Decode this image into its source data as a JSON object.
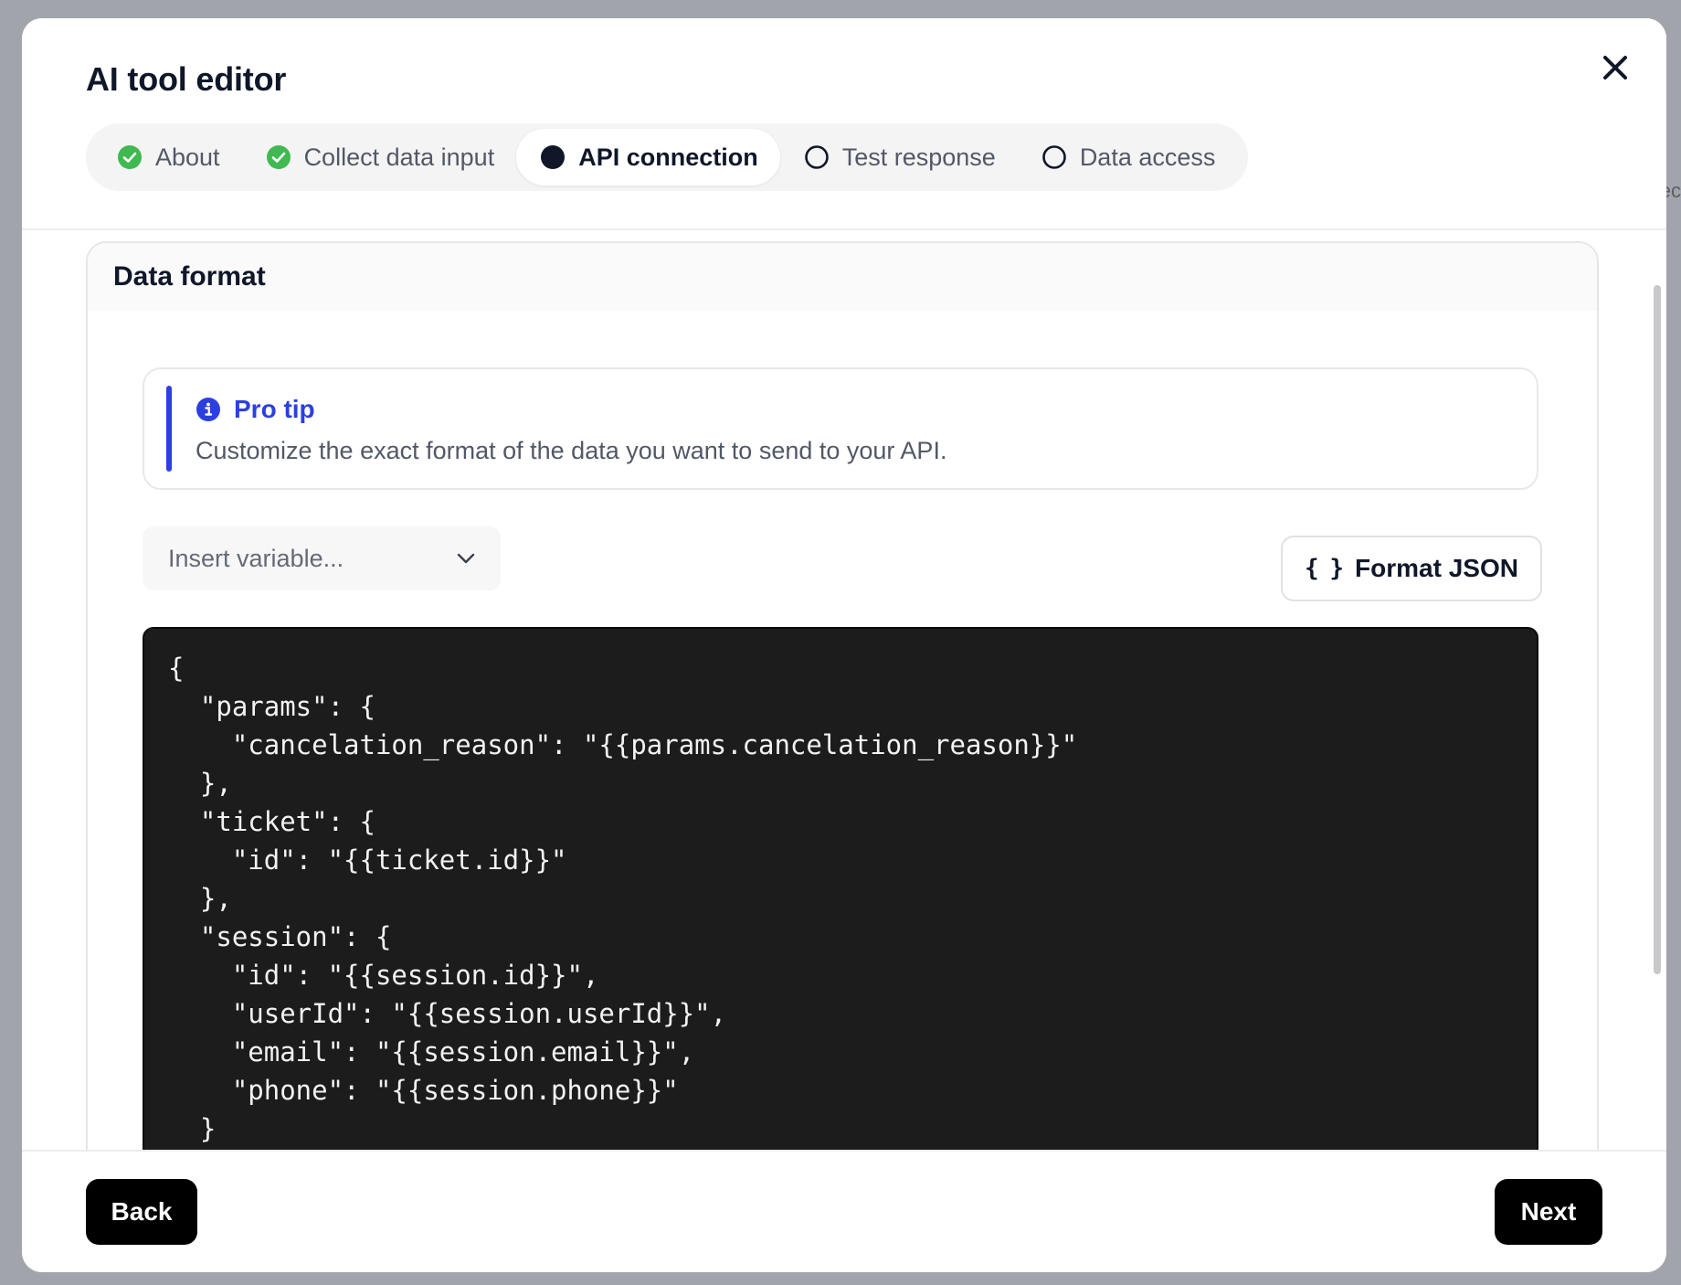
{
  "modal": {
    "title": "AI tool editor"
  },
  "steps": [
    {
      "label": "About",
      "state": "complete"
    },
    {
      "label": "Collect data input",
      "state": "complete"
    },
    {
      "label": "API connection",
      "state": "active"
    },
    {
      "label": "Test response",
      "state": "pending"
    },
    {
      "label": "Data access",
      "state": "pending"
    }
  ],
  "section": {
    "title": "Data format"
  },
  "tip": {
    "title": "Pro tip",
    "text": "Customize the exact format of the data you want to send to your API."
  },
  "insert_variable": {
    "placeholder": "Insert variable..."
  },
  "format_button": {
    "icon_text": "{ }",
    "label": "Format JSON"
  },
  "code": {
    "content": "{\n  \"params\": {\n    \"cancelation_reason\": \"{{params.cancelation_reason}}\"\n  },\n  \"ticket\": {\n    \"id\": \"{{ticket.id}}\"\n  },\n  \"session\": {\n    \"id\": \"{{session.id}}\",\n    \"userId\": \"{{session.userId}}\",\n    \"email\": \"{{session.email}}\",\n    \"phone\": \"{{session.phone}}\"\n  }"
  },
  "footer": {
    "back_label": "Back",
    "next_label": "Next"
  },
  "colors": {
    "accent": "#2c3fe0",
    "check": "#3fb950",
    "dark": "#0f1729",
    "code_bg": "#1c1c1c"
  }
}
